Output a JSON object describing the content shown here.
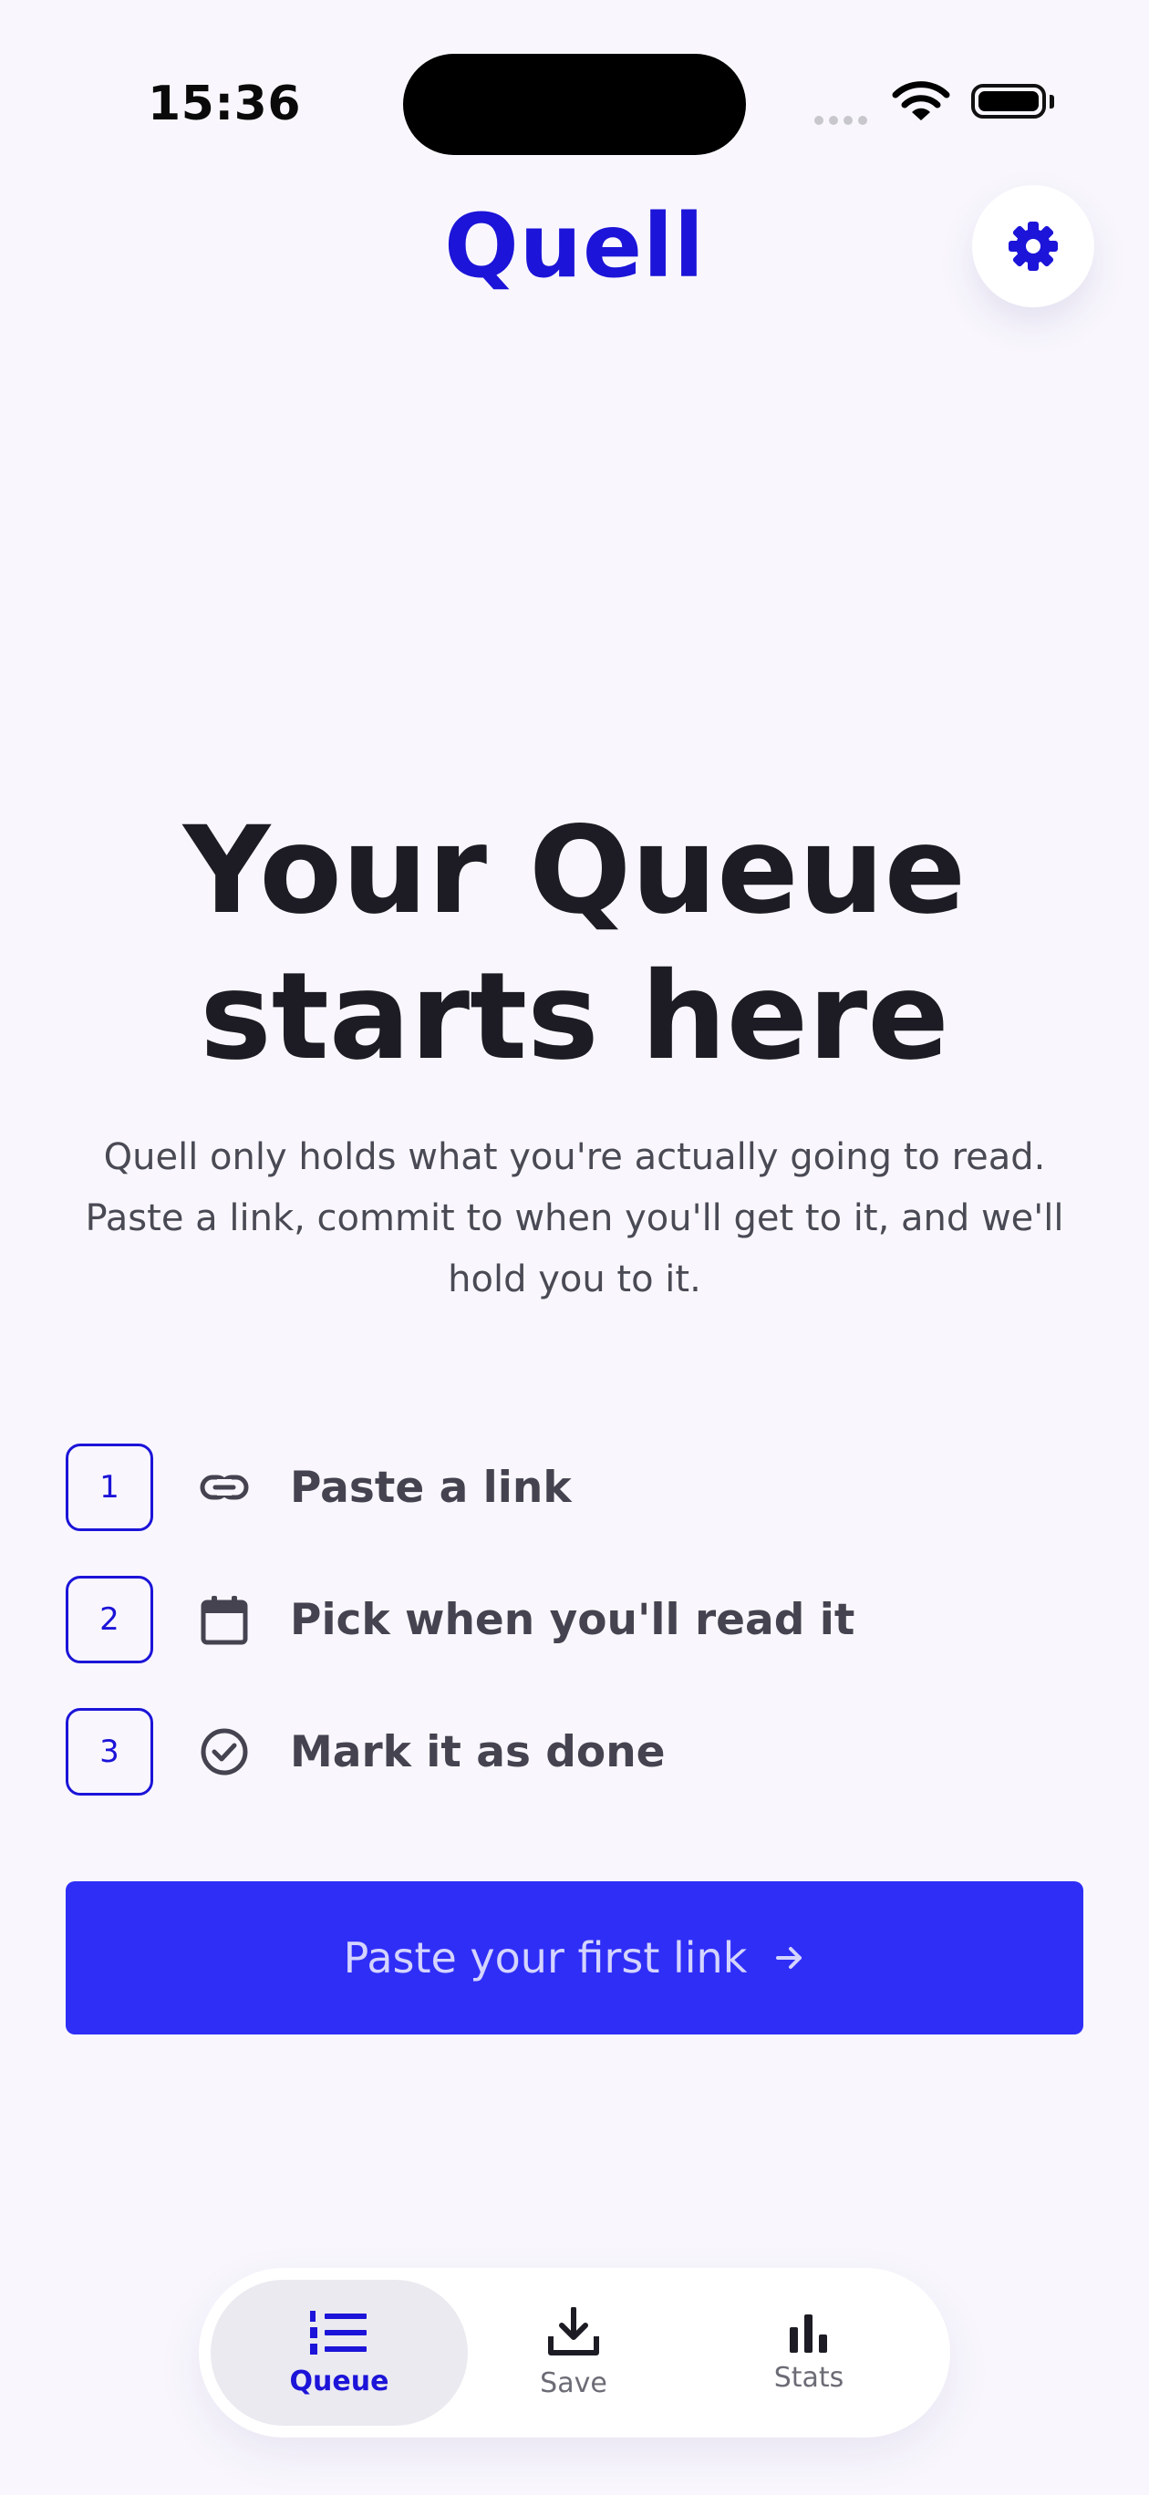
{
  "status_bar": {
    "time": "15:36"
  },
  "header": {
    "title": "Quell",
    "settings_icon": "gear-icon"
  },
  "hero": {
    "title_line1": "Your Queue",
    "title_line2": "starts here",
    "description": "Quell only holds what you're actually going to read. Paste a link, commit to when you'll get to it, and we'll hold you to it."
  },
  "steps": [
    {
      "number": "1",
      "icon": "link-icon",
      "label": "Paste a link"
    },
    {
      "number": "2",
      "icon": "calendar-icon",
      "label": "Pick when you'll read it"
    },
    {
      "number": "3",
      "icon": "check-circle-icon",
      "label": "Mark it as done"
    }
  ],
  "cta": {
    "label": "Paste your first link",
    "icon": "arrow-right-icon"
  },
  "tabs": [
    {
      "label": "Queue",
      "icon": "numbered-list-icon",
      "active": true
    },
    {
      "label": "Save",
      "icon": "download-icon",
      "active": false
    },
    {
      "label": "Stats",
      "icon": "bar-chart-icon",
      "active": false
    }
  ],
  "colors": {
    "brand": "#1c14d8",
    "cta": "#2f2ef7",
    "background": "#f9f7fd",
    "text": "#1d1c24"
  }
}
